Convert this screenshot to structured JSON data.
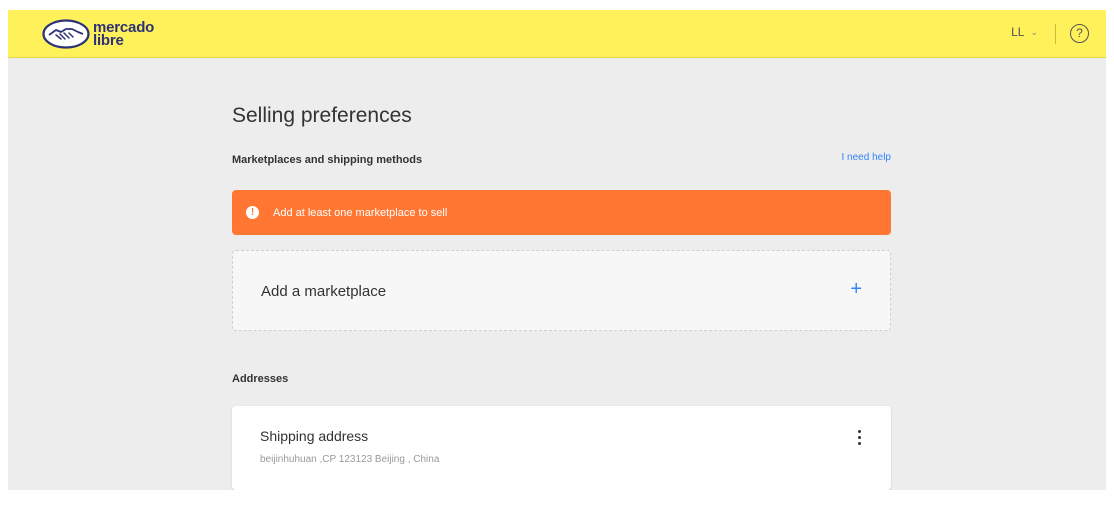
{
  "header": {
    "logo_line1": "mercado",
    "logo_line2": "libre",
    "user_initials": "LL",
    "help_symbol": "?",
    "icons": {
      "logo": "handshake-logo-icon",
      "user_chevron": "chevron-down-icon",
      "help": "help-circle-icon"
    },
    "colors": {
      "bar": "#fff159",
      "logo_text": "#2d3277"
    }
  },
  "page": {
    "title": "Selling preferences",
    "marketplaces_section": "Marketplaces and shipping methods",
    "help_link": "I need help",
    "alert": {
      "text": "Add at least one marketplace to sell",
      "icon": "exclamation-icon",
      "color": "#ff7733"
    },
    "add_marketplace": {
      "label": "Add a marketplace",
      "icon": "plus-icon",
      "icon_symbol": "+"
    },
    "addresses_section": "Addresses",
    "shipping_address": {
      "title": "Shipping address",
      "detail": "beijinhuhuan ,CP 123123 Beijing , China",
      "menu_icon": "kebab-menu-icon"
    },
    "accent_color": "#3483fa"
  }
}
